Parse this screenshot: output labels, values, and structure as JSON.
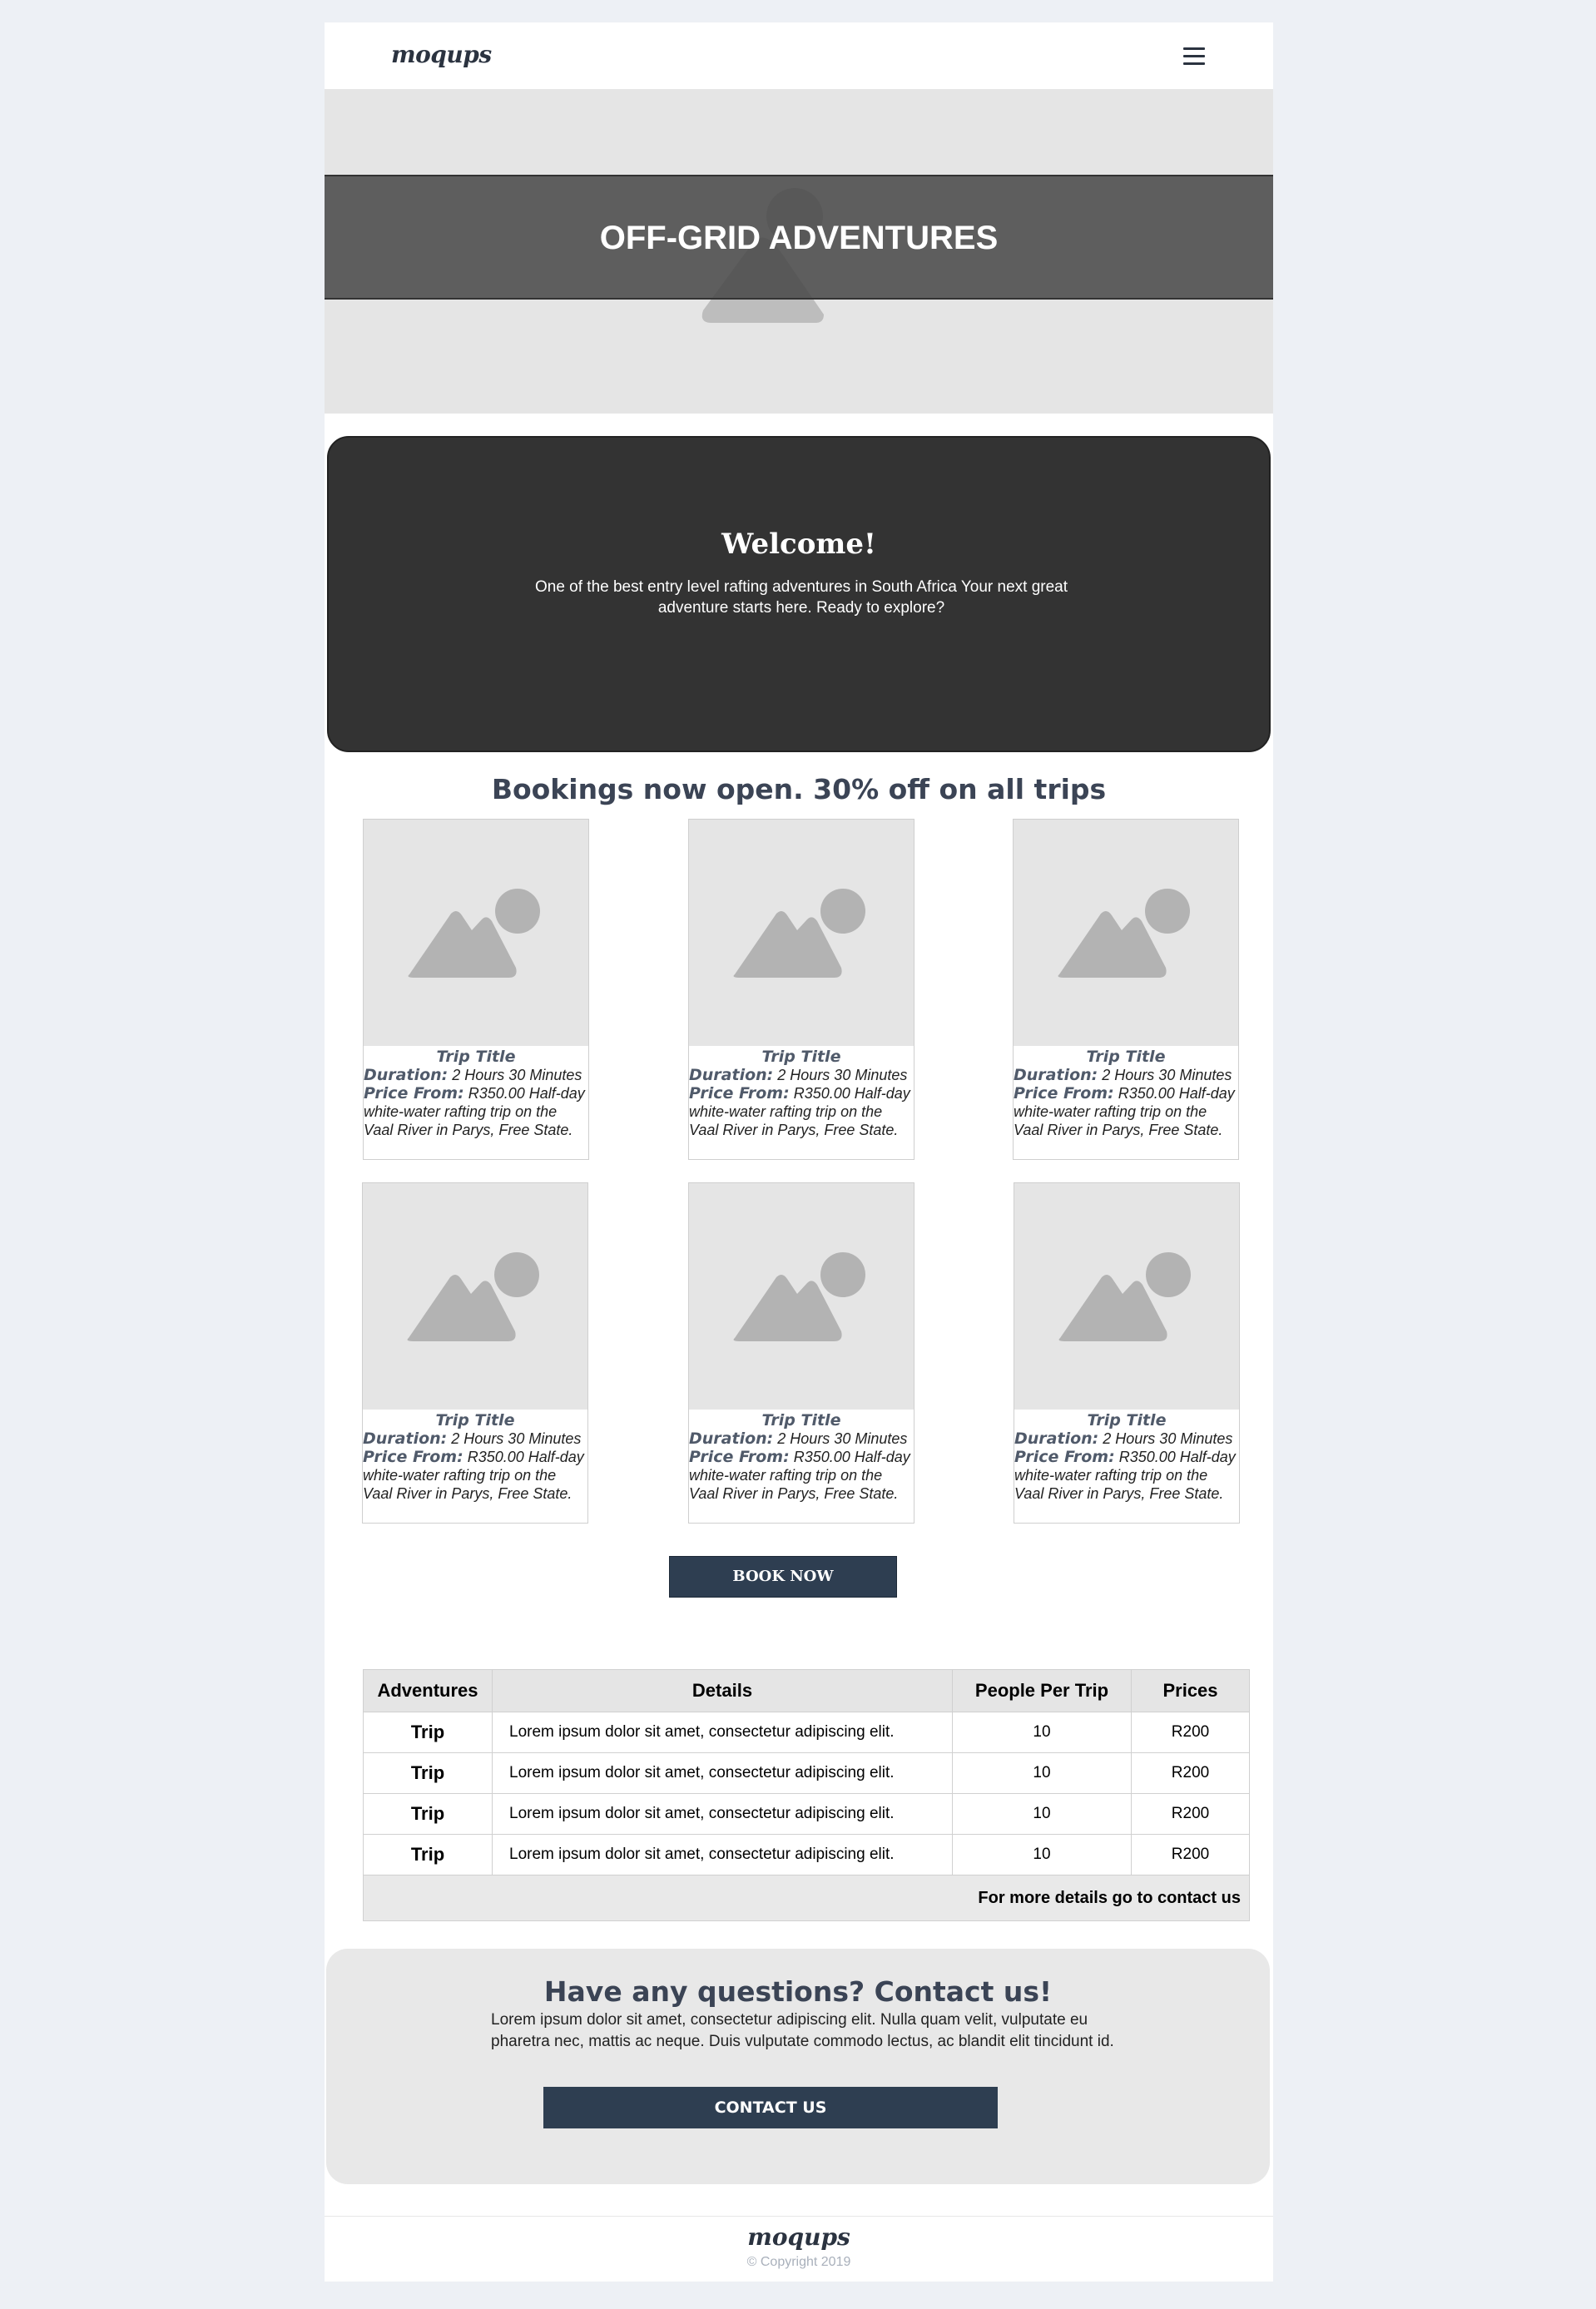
{
  "header": {
    "logo": "moqups",
    "menu_icon": "hamburger-menu-icon"
  },
  "hero": {
    "title": "OFF-GRID ADVENTURES",
    "image_icon": "person-placeholder-icon"
  },
  "welcome": {
    "title": "Welcome!",
    "text": "One of the best entry level rafting adventures in South Africa Your next great adventure starts here. Ready to explore?"
  },
  "bookings": {
    "title": "Bookings now open. 30% off on all trips",
    "card_image_icon": "image-placeholder-icon",
    "cards": [
      {
        "title": "Trip Title",
        "duration_label": "Duration:",
        "duration": "2 Hours 30 Minutes",
        "price_label": "Price From:",
        "price_text": "R350.00 Half-day white-water rafting trip on the Vaal River in Parys, Free State."
      },
      {
        "title": "Trip Title",
        "duration_label": "Duration:",
        "duration": "2 Hours 30 Minutes",
        "price_label": "Price From:",
        "price_text": "R350.00 Half-day white-water rafting trip on the Vaal River in Parys, Free State."
      },
      {
        "title": "Trip Title",
        "duration_label": "Duration:",
        "duration": "2 Hours 30 Minutes",
        "price_label": "Price From:",
        "price_text": "R350.00 Half-day white-water rafting trip on the Vaal River in Parys, Free State."
      },
      {
        "title": "Trip Title",
        "duration_label": "Duration:",
        "duration": "2 Hours 30 Minutes",
        "price_label": "Price From:",
        "price_text": "R350.00 Half-day white-water rafting trip on the Vaal River in Parys, Free State."
      },
      {
        "title": "Trip Title",
        "duration_label": "Duration:",
        "duration": "2 Hours 30 Minutes",
        "price_label": "Price From:",
        "price_text": "R350.00 Half-day white-water rafting trip on the Vaal River in Parys, Free State."
      },
      {
        "title": "Trip Title",
        "duration_label": "Duration:",
        "duration": "2 Hours 30 Minutes",
        "price_label": "Price From:",
        "price_text": "R350.00 Half-day white-water rafting trip on the Vaal River in Parys, Free State."
      }
    ],
    "book_button": "BOOK NOW"
  },
  "table": {
    "headers": [
      "Adventures",
      "Details",
      "People Per Trip",
      "Prices"
    ],
    "rows": [
      [
        "Trip",
        "Lorem ipsum dolor sit amet, consectetur adipiscing elit.",
        "10",
        "R200"
      ],
      [
        "Trip",
        "Lorem ipsum dolor sit amet, consectetur adipiscing elit.",
        "10",
        "R200"
      ],
      [
        "Trip",
        "Lorem ipsum dolor sit amet, consectetur adipiscing elit.",
        "10",
        "R200"
      ],
      [
        "Trip",
        "Lorem ipsum dolor sit amet, consectetur adipiscing elit.",
        "10",
        "R200"
      ]
    ],
    "footer": "For more details go to contact us"
  },
  "contact": {
    "title": "Have any questions? Contact us!",
    "text": "Lorem ipsum dolor sit amet, consectetur adipiscing elit. Nulla quam velit, vulputate eu pharetra nec, mattis ac neque. Duis vulputate commodo lectus, ac blandit elit tincidunt id.",
    "button": "CONTACT US"
  },
  "footer": {
    "logo": "moqups",
    "copyright": "© Copyright 2019"
  },
  "colors": {
    "background": "#edf0f5",
    "accent": "#2e3e51",
    "dark_panel": "#333333",
    "placeholder": "#e5e5e5"
  }
}
